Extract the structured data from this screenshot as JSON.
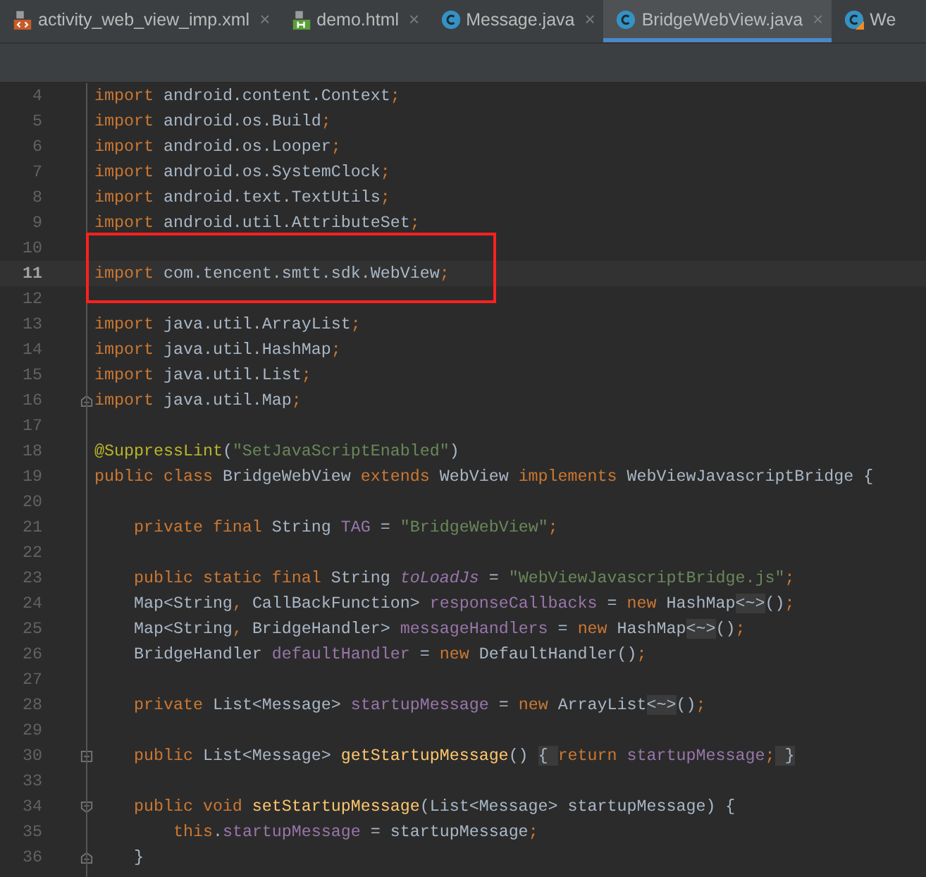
{
  "tabs": [
    {
      "label": "activity_web_view_imp.xml",
      "kind": "xml",
      "selected": false,
      "close": "×"
    },
    {
      "label": "demo.html",
      "kind": "html",
      "selected": false,
      "close": "×"
    },
    {
      "label": "Message.java",
      "kind": "java",
      "selected": false,
      "close": "×"
    },
    {
      "label": "BridgeWebView.java",
      "kind": "java",
      "selected": true,
      "close": "×"
    },
    {
      "label": "We",
      "kind": "kotlin",
      "selected": false
    }
  ],
  "editor": {
    "lines": [
      {
        "number": "4",
        "current": false,
        "tokens": [
          {
            "t": "import ",
            "kind": "kw"
          },
          {
            "t": "android.content.Context",
            "kind": "plain"
          },
          {
            "t": ";",
            "kind": "kw"
          }
        ]
      },
      {
        "number": "5",
        "current": false,
        "tokens": [
          {
            "t": "import ",
            "kind": "kw"
          },
          {
            "t": "android.os.Build",
            "kind": "plain"
          },
          {
            "t": ";",
            "kind": "kw"
          }
        ]
      },
      {
        "number": "6",
        "current": false,
        "tokens": [
          {
            "t": "import ",
            "kind": "kw"
          },
          {
            "t": "android.os.Looper",
            "kind": "plain"
          },
          {
            "t": ";",
            "kind": "kw"
          }
        ]
      },
      {
        "number": "7",
        "current": false,
        "tokens": [
          {
            "t": "import ",
            "kind": "kw"
          },
          {
            "t": "android.os.SystemClock",
            "kind": "plain"
          },
          {
            "t": ";",
            "kind": "kw"
          }
        ]
      },
      {
        "number": "8",
        "current": false,
        "tokens": [
          {
            "t": "import ",
            "kind": "kw"
          },
          {
            "t": "android.text.TextUtils",
            "kind": "plain"
          },
          {
            "t": ";",
            "kind": "kw"
          }
        ]
      },
      {
        "number": "9",
        "current": false,
        "tokens": [
          {
            "t": "import ",
            "kind": "kw"
          },
          {
            "t": "android.util.AttributeSet",
            "kind": "plain"
          },
          {
            "t": ";",
            "kind": "kw"
          }
        ]
      },
      {
        "number": "10",
        "current": false
      },
      {
        "number": "11",
        "current": true,
        "tokens": [
          {
            "t": "import ",
            "kind": "kw"
          },
          {
            "t": "com.tencent.smtt.sdk.WebView",
            "kind": "plain"
          },
          {
            "t": ";",
            "kind": "kw"
          }
        ]
      },
      {
        "number": "12",
        "current": false
      },
      {
        "number": "13",
        "current": false,
        "tokens": [
          {
            "t": "import ",
            "kind": "kw"
          },
          {
            "t": "java.util.ArrayList",
            "kind": "plain"
          },
          {
            "t": ";",
            "kind": "kw"
          }
        ]
      },
      {
        "number": "14",
        "current": false,
        "tokens": [
          {
            "t": "import ",
            "kind": "kw"
          },
          {
            "t": "java.util.HashMap",
            "kind": "plain"
          },
          {
            "t": ";",
            "kind": "kw"
          }
        ]
      },
      {
        "number": "15",
        "current": false,
        "tokens": [
          {
            "t": "import ",
            "kind": "kw"
          },
          {
            "t": "java.util.List",
            "kind": "plain"
          },
          {
            "t": ";",
            "kind": "kw"
          }
        ]
      },
      {
        "number": "16",
        "current": false,
        "fold": {
          "kind": "end"
        },
        "tokens": [
          {
            "t": "import ",
            "kind": "kw"
          },
          {
            "t": "java.util.Map",
            "kind": "plain"
          },
          {
            "t": ";",
            "kind": "kw"
          }
        ]
      },
      {
        "number": "17",
        "current": false
      },
      {
        "number": "18",
        "current": false,
        "tokens": [
          {
            "t": "@SuppressLint",
            "kind": "annot"
          },
          {
            "t": "(",
            "kind": "plain"
          },
          {
            "t": "\"SetJavaScriptEnabled\"",
            "kind": "str"
          },
          {
            "t": ")",
            "kind": "plain"
          }
        ]
      },
      {
        "number": "19",
        "current": false,
        "tokens": [
          {
            "t": "public class ",
            "kind": "kw"
          },
          {
            "t": "BridgeWebView ",
            "kind": "plain"
          },
          {
            "t": "extends ",
            "kind": "kw"
          },
          {
            "t": "WebView ",
            "kind": "plain"
          },
          {
            "t": "implements ",
            "kind": "kw"
          },
          {
            "t": "WebViewJavascriptBridge {",
            "kind": "plain"
          }
        ]
      },
      {
        "number": "20",
        "current": false
      },
      {
        "number": "21",
        "current": false,
        "tokens": [
          {
            "t": "    private final ",
            "kind": "kw"
          },
          {
            "t": "String ",
            "kind": "plain"
          },
          {
            "t": "TAG",
            "kind": "field"
          },
          {
            "t": " = ",
            "kind": "plain"
          },
          {
            "t": "\"BridgeWebView\"",
            "kind": "str"
          },
          {
            "t": ";",
            "kind": "kw"
          }
        ]
      },
      {
        "number": "22",
        "current": false
      },
      {
        "number": "23",
        "current": false,
        "tokens": [
          {
            "t": "    public static final ",
            "kind": "kw"
          },
          {
            "t": "String ",
            "kind": "plain"
          },
          {
            "t": "toLoadJs",
            "kind": "static"
          },
          {
            "t": " = ",
            "kind": "plain"
          },
          {
            "t": "\"WebViewJavascriptBridge.js\"",
            "kind": "str"
          },
          {
            "t": ";",
            "kind": "kw"
          }
        ]
      },
      {
        "number": "24",
        "current": false,
        "tokens": [
          {
            "t": "    Map<String",
            "kind": "plain"
          },
          {
            "t": ", ",
            "kind": "kw"
          },
          {
            "t": "CallBackFunction> ",
            "kind": "plain"
          },
          {
            "t": "responseCallbacks",
            "kind": "field"
          },
          {
            "t": " = ",
            "kind": "plain"
          },
          {
            "t": "new ",
            "kind": "kw"
          },
          {
            "t": "HashMap",
            "kind": "plain"
          },
          {
            "t": "<~>",
            "kind": "folded"
          },
          {
            "t": "()",
            "kind": "plain"
          },
          {
            "t": ";",
            "kind": "kw"
          }
        ]
      },
      {
        "number": "25",
        "current": false,
        "tokens": [
          {
            "t": "    Map<String",
            "kind": "plain"
          },
          {
            "t": ", ",
            "kind": "kw"
          },
          {
            "t": "BridgeHandler> ",
            "kind": "plain"
          },
          {
            "t": "messageHandlers",
            "kind": "field"
          },
          {
            "t": " = ",
            "kind": "plain"
          },
          {
            "t": "new ",
            "kind": "kw"
          },
          {
            "t": "HashMap",
            "kind": "plain"
          },
          {
            "t": "<~>",
            "kind": "folded"
          },
          {
            "t": "()",
            "kind": "plain"
          },
          {
            "t": ";",
            "kind": "kw"
          }
        ]
      },
      {
        "number": "26",
        "current": false,
        "tokens": [
          {
            "t": "    BridgeHandler ",
            "kind": "plain"
          },
          {
            "t": "defaultHandler",
            "kind": "field"
          },
          {
            "t": " = ",
            "kind": "plain"
          },
          {
            "t": "new ",
            "kind": "kw"
          },
          {
            "t": "DefaultHandler()",
            "kind": "plain"
          },
          {
            "t": ";",
            "kind": "kw"
          }
        ]
      },
      {
        "number": "27",
        "current": false
      },
      {
        "number": "28",
        "current": false,
        "tokens": [
          {
            "t": "    private ",
            "kind": "kw"
          },
          {
            "t": "List<Message> ",
            "kind": "plain"
          },
          {
            "t": "startupMessage",
            "kind": "field"
          },
          {
            "t": " = ",
            "kind": "plain"
          },
          {
            "t": "new ",
            "kind": "kw"
          },
          {
            "t": "ArrayList",
            "kind": "plain"
          },
          {
            "t": "<~>",
            "kind": "folded"
          },
          {
            "t": "()",
            "kind": "plain"
          },
          {
            "t": ";",
            "kind": "kw"
          }
        ]
      },
      {
        "number": "29",
        "current": false
      },
      {
        "number": "30",
        "current": false,
        "fold": {
          "kind": "collapsed"
        },
        "tokens": [
          {
            "t": "    public ",
            "kind": "kw"
          },
          {
            "t": "List<Message> ",
            "kind": "plain"
          },
          {
            "t": "getStartupMessage",
            "kind": "method"
          },
          {
            "t": "() ",
            "kind": "plain"
          },
          {
            "t": "{ ",
            "kind": "folded"
          },
          {
            "t": "return ",
            "kind": "kw"
          },
          {
            "t": "startupMessage",
            "kind": "field"
          },
          {
            "t": ";",
            "kind": "kw"
          },
          {
            "t": " }",
            "kind": "folded"
          }
        ]
      },
      {
        "number": "33",
        "current": false
      },
      {
        "number": "34",
        "current": false,
        "fold": {
          "kind": "start"
        },
        "tokens": [
          {
            "t": "    public void ",
            "kind": "kw"
          },
          {
            "t": "setStartupMessage",
            "kind": "method"
          },
          {
            "t": "(List<Message> startupMessage) {",
            "kind": "plain"
          }
        ]
      },
      {
        "number": "35",
        "current": false,
        "tokens": [
          {
            "t": "        this",
            "kind": "kw"
          },
          {
            "t": ".",
            "kind": "plain"
          },
          {
            "t": "startupMessage",
            "kind": "field"
          },
          {
            "t": " = startupMessage",
            "kind": "plain"
          },
          {
            "t": ";",
            "kind": "kw"
          }
        ]
      },
      {
        "number": "36",
        "current": false,
        "fold": {
          "kind": "end"
        },
        "tokens": [
          {
            "t": "    }",
            "kind": "plain"
          }
        ]
      }
    ]
  }
}
